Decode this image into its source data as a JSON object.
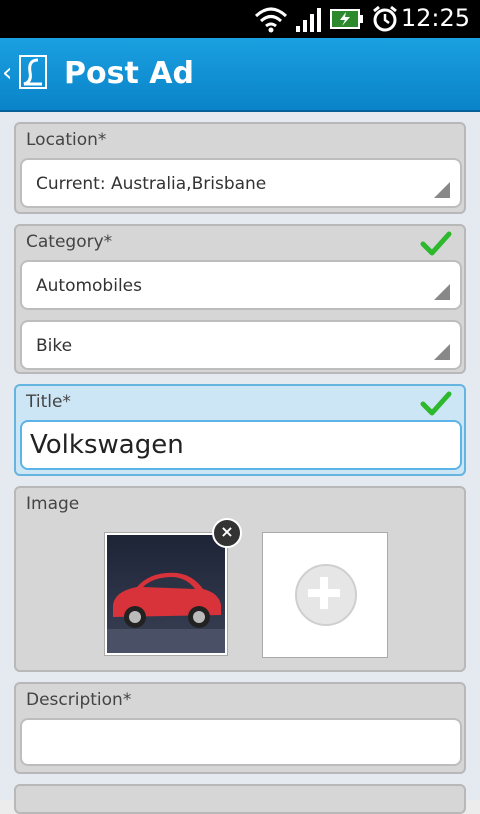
{
  "status_bar": {
    "time": "12:25"
  },
  "action_bar": {
    "back": "‹",
    "title": "Post Ad"
  },
  "location": {
    "label": "Location*",
    "value": "Current: Australia,Brisbane"
  },
  "category": {
    "label": "Category*",
    "primary": "Automobiles",
    "secondary": "Bike"
  },
  "title_field": {
    "label": "Title*",
    "value": "Volkswagen"
  },
  "image": {
    "label": "Image"
  },
  "description": {
    "label": "Description*",
    "value": ""
  },
  "colors": {
    "accent": "#0a83c9",
    "check": "#2eb82e"
  }
}
